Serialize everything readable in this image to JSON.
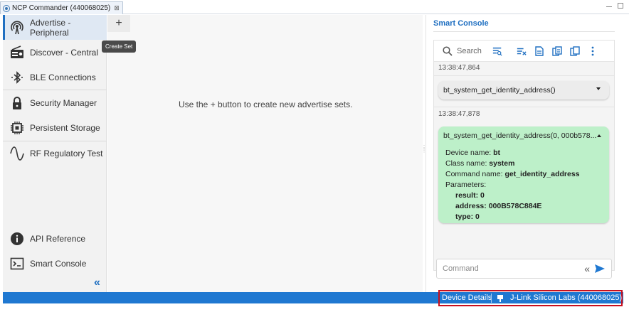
{
  "window": {
    "tab_title": "NCP Commander (440068025)",
    "tab_close": "⊠"
  },
  "nav": {
    "items": [
      {
        "label": "Advertise - Peripheral",
        "icon": "broadcast-icon",
        "active": true
      },
      {
        "label": "Discover - Central",
        "icon": "radio-icon"
      },
      {
        "label": "BLE Connections",
        "icon": "bluetooth-icon"
      },
      {
        "label": "Security Manager",
        "icon": "lock-icon"
      },
      {
        "label": "Persistent Storage",
        "icon": "chip-icon"
      },
      {
        "label": "RF Regulatory Test",
        "icon": "sine-wave-icon"
      }
    ],
    "bottom_items": [
      {
        "label": "API Reference",
        "icon": "info-icon"
      },
      {
        "label": "Smart Console",
        "icon": "terminal-icon"
      }
    ],
    "collapse_glyph": "«"
  },
  "center": {
    "add_glyph": "+",
    "tooltip": "Create Set",
    "hint": "Use the + button to create new advertise sets."
  },
  "console": {
    "title": "Smart Console",
    "search_placeholder": "Search",
    "entries": [
      {
        "timestamp": "13:38:47,864",
        "command": "bt_system_get_identity_address()",
        "expanded": false
      },
      {
        "timestamp": "13:38:47,878",
        "command": "bt_system_get_identity_address(0, 000b578...",
        "expanded": true,
        "details": {
          "device_label": "Device name:",
          "device_value": "bt",
          "class_label": "Class name:",
          "class_value": "system",
          "command_label": "Command name:",
          "command_value": "get_identity_address",
          "params_label": "Parameters:",
          "params": [
            {
              "label": "result:",
              "value": "0"
            },
            {
              "label": "address:",
              "value": "000B578C884E"
            },
            {
              "label": "type:",
              "value": "0"
            }
          ]
        }
      }
    ],
    "input_placeholder": "Command",
    "input_glyph": "«"
  },
  "statusbar": {
    "device_details": "Device Details",
    "connection": "J-Link Silicon Labs (440068025)"
  },
  "colors": {
    "accent": "#1f78d1",
    "highlight_border": "#c8101e",
    "response_green": "#bdf0c9"
  }
}
